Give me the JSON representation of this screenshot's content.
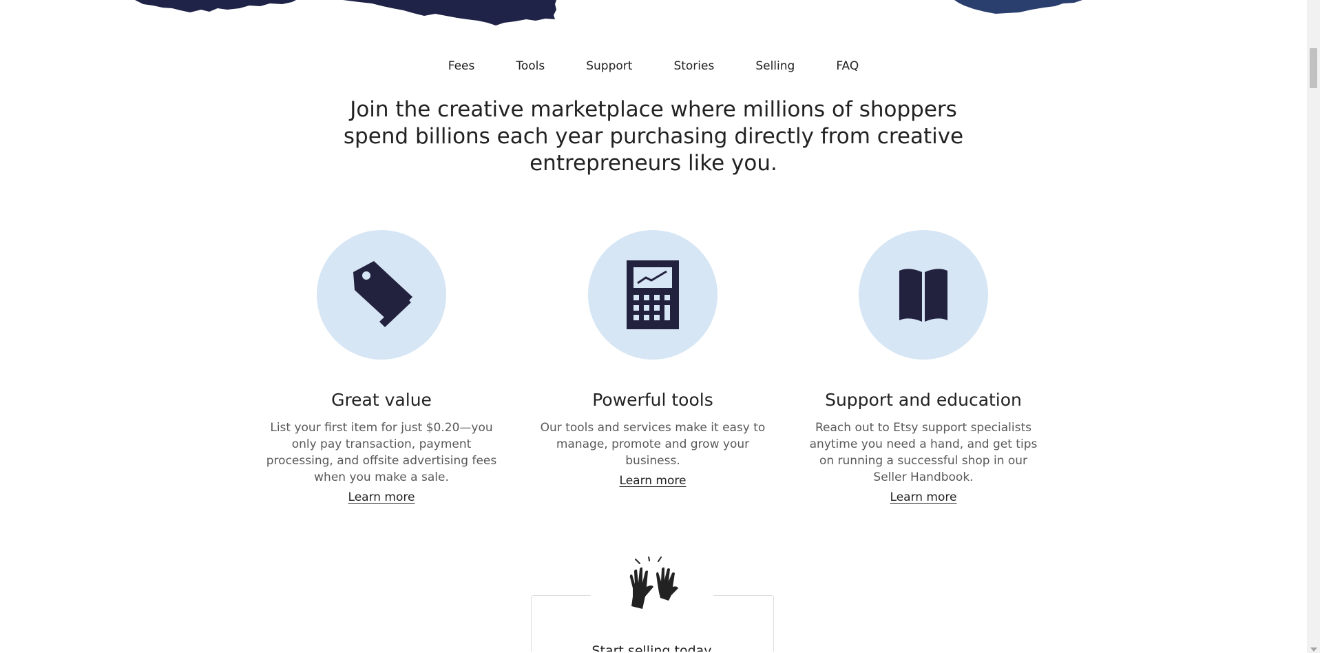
{
  "nav": {
    "items": [
      "Fees",
      "Tools",
      "Support",
      "Stories",
      "Selling",
      "FAQ"
    ]
  },
  "headline": "Join the creative marketplace where millions of shoppers spend billions each year purchasing directly from creative entrepreneurs like you.",
  "features": [
    {
      "icon": "price-tag-icon",
      "title": "Great value",
      "description": "List your first item for just $0.20—you only pay transaction, payment processing, and offsite advertising fees when you make a sale.",
      "link": "Learn more"
    },
    {
      "icon": "calculator-icon",
      "title": "Powerful tools",
      "description": "Our tools and services make it easy to manage, promote and grow your business.",
      "link": "Learn more"
    },
    {
      "icon": "open-book-icon",
      "title": "Support and education",
      "description": "Reach out to Etsy support specialists anytime you need a hand, and get tips on running a successful shop in our Seller Handbook.",
      "link": "Learn more"
    }
  ],
  "cta": {
    "icon": "clapping-hands-icon",
    "title": "Start selling today"
  },
  "colors": {
    "accent_navy": "#22223f",
    "circle_bg": "#d7e6f5",
    "torn_paper": "#1f2347"
  }
}
